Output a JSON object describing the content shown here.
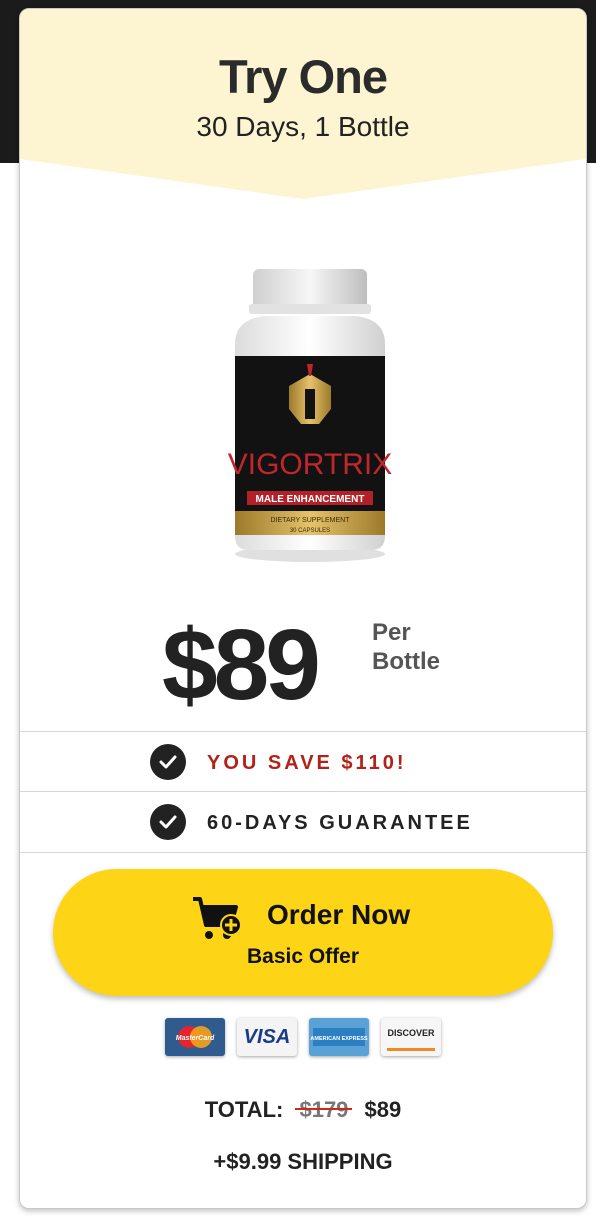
{
  "header": {
    "title": "Try One",
    "subtitle": "30 Days, 1 Bottle",
    "background_color": "#fdf4d2"
  },
  "product": {
    "brand": "VIGORTRIX",
    "label_tag": "MALE ENHANCEMENT",
    "label_lines": [
      "DIETARY SUPPLEMENT",
      "30 CAPSULES"
    ]
  },
  "price": {
    "amount": "$89",
    "per_line1": "Per",
    "per_line2": "Bottle"
  },
  "benefits": [
    {
      "text": "YOU SAVE $110!",
      "color": "#b32218",
      "icon": "check-icon"
    },
    {
      "text": "60-DAYS GUARANTEE",
      "color": "#222222",
      "icon": "check-icon"
    }
  ],
  "order_button": {
    "label": "Order Now",
    "sublabel": "Basic Offer",
    "icon": "cart-plus-icon",
    "color": "#fdd416"
  },
  "payment_cards": [
    {
      "name": "MasterCard",
      "icon": "mastercard-icon"
    },
    {
      "name": "VISA",
      "icon": "visa-icon"
    },
    {
      "name": "AMERICAN EXPRESS",
      "icon": "amex-icon"
    },
    {
      "name": "DISCOVER",
      "icon": "discover-icon"
    }
  ],
  "total": {
    "label": "TOTAL:",
    "old_price": "$179",
    "new_price": "$89"
  },
  "shipping": "+$9.99 SHIPPING"
}
